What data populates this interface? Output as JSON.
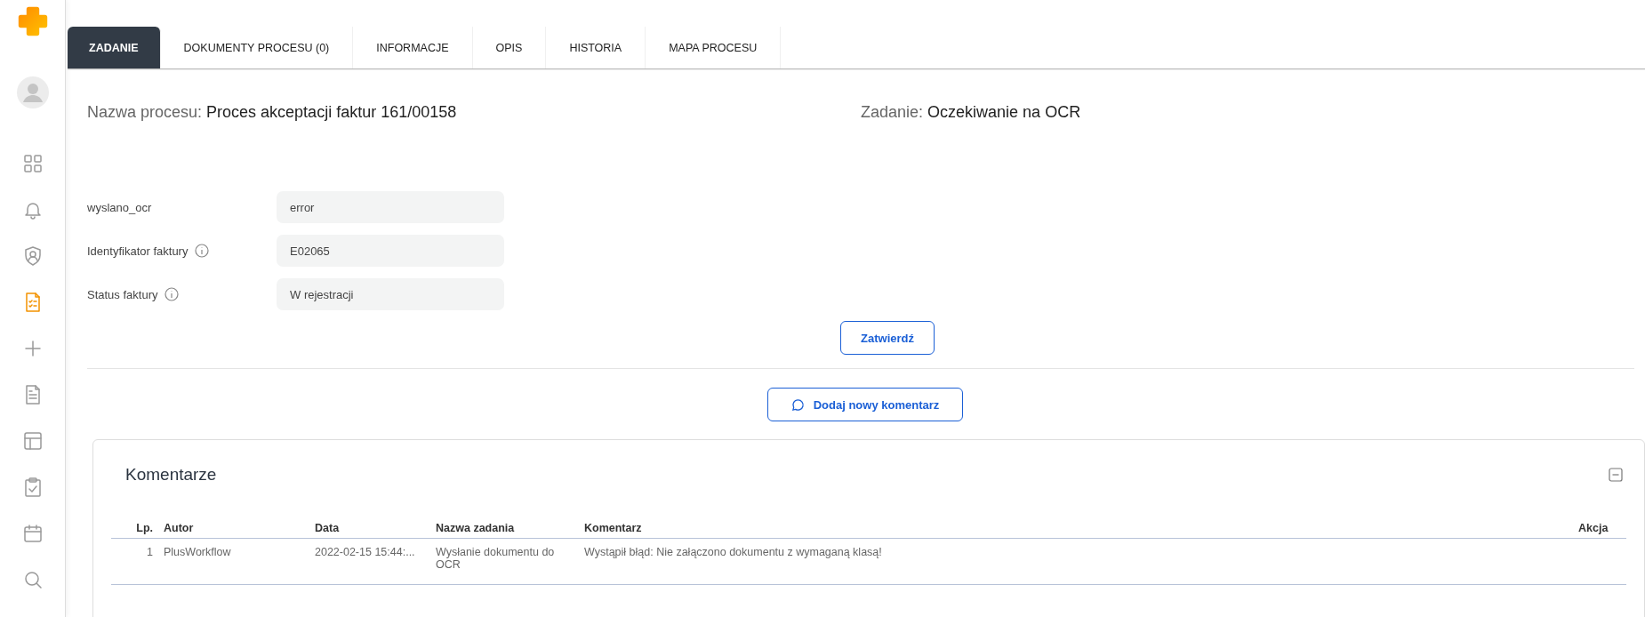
{
  "sidebar": {
    "items": [
      {
        "kind": "grid",
        "selected": false
      },
      {
        "kind": "bell",
        "selected": false
      },
      {
        "kind": "shield",
        "selected": false
      },
      {
        "kind": "checklist",
        "selected": true
      },
      {
        "kind": "plus",
        "selected": false
      },
      {
        "kind": "document",
        "selected": false
      },
      {
        "kind": "layout",
        "selected": false
      },
      {
        "kind": "clipboard",
        "selected": false
      },
      {
        "kind": "calendar",
        "selected": false
      },
      {
        "kind": "search",
        "selected": false
      }
    ]
  },
  "tabs": [
    {
      "label": "ZADANIE",
      "selected": true
    },
    {
      "label": "DOKUMENTY PROCESU (0)",
      "selected": false
    },
    {
      "label": "INFORMACJE",
      "selected": false
    },
    {
      "label": "OPIS",
      "selected": false
    },
    {
      "label": "HISTORIA",
      "selected": false
    },
    {
      "label": "MAPA PROCESU",
      "selected": false
    }
  ],
  "header": {
    "process_label": "Nazwa procesu:",
    "process_value": "Proces akceptacji faktur 161/00158",
    "task_label": "Zadanie:",
    "task_value": "Oczekiwanie na OCR"
  },
  "fields": [
    {
      "label": "wyslano_ocr",
      "info": false,
      "value": "error"
    },
    {
      "label": "Identyfikator faktury",
      "info": true,
      "value": "E02065"
    },
    {
      "label": "Status faktury",
      "info": true,
      "value": "W rejestracji"
    }
  ],
  "confirm_button": "Zatwierdź",
  "add_comment_button": "Dodaj nowy komentarz",
  "comments": {
    "title": "Komentarze",
    "expanded": true,
    "columns": [
      "Lp.",
      "Autor",
      "Data",
      "Nazwa zadania",
      "Komentarz",
      "Akcja"
    ],
    "rows": [
      [
        "1",
        "PlusWorkflow",
        "2022-02-15 15:44:...",
        "Wysłanie dokumentu do OCR",
        "Wystąpił błąd: Nie załączono dokumentu z wymaganą klasą!",
        ""
      ]
    ]
  }
}
